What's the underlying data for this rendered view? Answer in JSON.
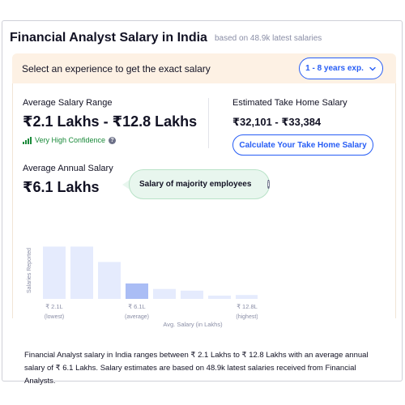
{
  "header": {
    "title": "Financial Analyst Salary in India",
    "subtitle": "based on 48.9k latest salaries"
  },
  "experience": {
    "prompt": "Select an experience to get the exact salary",
    "selected": "1 - 8 years exp."
  },
  "salary_range": {
    "label": "Average Salary Range",
    "value": "₹2.1 Lakhs - ₹12.8 Lakhs",
    "confidence": "Very High Confidence"
  },
  "take_home": {
    "label": "Estimated Take Home Salary",
    "value": "₹32,101 - ₹33,384",
    "button": "Calculate Your Take Home Salary"
  },
  "annual": {
    "label": "Average Annual Salary",
    "value": "₹6.1 Lakhs",
    "tooltip": "Salary of majority employees"
  },
  "chart_data": {
    "type": "bar",
    "ylabel": "Salaries Reported",
    "xlabel": "Avg. Salary (in Lakhs)",
    "values": [
      0.95,
      0.95,
      0.67,
      0.28,
      0.18,
      0.15,
      0.06,
      0.07
    ],
    "highlight_index": 3,
    "tick_labels": [
      {
        "index": 0,
        "value": "₹ 2.1L",
        "note": "(lowest)"
      },
      {
        "index": 3,
        "value": "₹ 6.1L",
        "note": "(average)"
      },
      {
        "index": 7,
        "value": "₹ 12.8L",
        "note": "(highest)"
      }
    ],
    "colors": {
      "bar": "#e5ebfd",
      "highlight": "#aabdf5",
      "axis": "#8a8ea6"
    }
  },
  "description": "Financial Analyst salary in India ranges between ₹ 2.1 Lakhs to ₹ 12.8 Lakhs with an average annual salary of ₹ 6.1 Lakhs. Salary estimates are based on 48.9k latest salaries received from Financial Analysts."
}
